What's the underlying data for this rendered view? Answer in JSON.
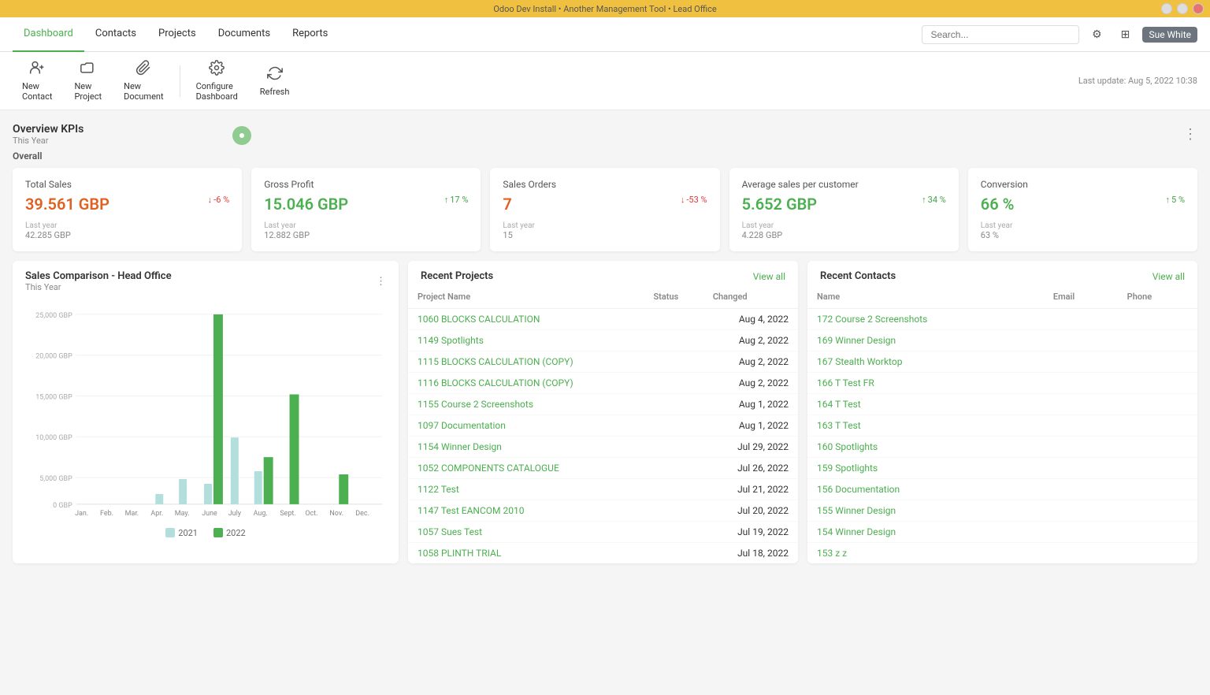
{
  "titleBar": {
    "text": "Odoo Dev Install • Another Management Tool • Lead Office",
    "windowButtons": [
      "minimize",
      "maximize",
      "close"
    ]
  },
  "nav": {
    "items": [
      {
        "label": "Dashboard",
        "active": true
      },
      {
        "label": "Contacts",
        "active": false
      },
      {
        "label": "Projects",
        "active": false
      },
      {
        "label": "Documents",
        "active": false
      },
      {
        "label": "Reports",
        "active": false
      }
    ],
    "search": {
      "placeholder": "Search..."
    },
    "lastUpdate": "Last update: Aug 5, 2022 10:38",
    "userLabel": "Sue White"
  },
  "toolbar": {
    "items": [
      {
        "id": "new-contact",
        "label": "New\nContact",
        "icon": "👤"
      },
      {
        "id": "new-project",
        "label": "New\nProject",
        "icon": "📁"
      },
      {
        "id": "new-document",
        "label": "New\nDocument",
        "icon": "📎"
      },
      {
        "id": "configure-dashboard",
        "label": "Configure\nDashboard",
        "icon": "⚙"
      },
      {
        "id": "refresh",
        "label": "Refresh",
        "icon": "↻"
      }
    ]
  },
  "overviewKPIs": {
    "title": "Overview KPIs",
    "subtitle": "This Year",
    "section": "Overall",
    "cards": [
      {
        "label": "Total Sales",
        "value": "39.561 GBP",
        "valueColor": "red",
        "change": "-6 %",
        "changeDir": "down",
        "lastYearLabel": "Last year",
        "lastYearValue": "42.285 GBP"
      },
      {
        "label": "Gross Profit",
        "value": "15.046 GBP",
        "valueColor": "green",
        "change": "17 %",
        "changeDir": "up",
        "lastYearLabel": "Last year",
        "lastYearValue": "12.882 GBP"
      },
      {
        "label": "Sales Orders",
        "value": "7",
        "valueColor": "red",
        "change": "-53 %",
        "changeDir": "down",
        "lastYearLabel": "Last year",
        "lastYearValue": "15"
      },
      {
        "label": "Average sales per customer",
        "value": "5.652 GBP",
        "valueColor": "green",
        "change": "34 %",
        "changeDir": "up",
        "lastYearLabel": "Last year",
        "lastYearValue": "4.228 GBP"
      },
      {
        "label": "Conversion",
        "value": "66 %",
        "valueColor": "green",
        "change": "5 %",
        "changeDir": "up",
        "lastYearLabel": "Last year",
        "lastYearValue": "63 %"
      }
    ]
  },
  "salesComparison": {
    "title": "Sales Comparison  -  Head Office",
    "subtitle": "This Year",
    "legend": [
      {
        "label": "2021",
        "color": "#b2dfdb"
      },
      {
        "label": "2022",
        "color": "#4CAF50"
      }
    ],
    "months": [
      "Jan.",
      "Feb.",
      "Mar.",
      "Apr.",
      "May.",
      "June",
      "July",
      "Aug.",
      "Sept.",
      "Oct.",
      "Nov.",
      "Dec."
    ],
    "yLabels": [
      "25,000 GBP",
      "20,000 GBP",
      "15,000 GBP",
      "10,000 GBP",
      "5,000 GBP",
      "0 GBP"
    ],
    "data2021": [
      0,
      0,
      0,
      1200,
      3200,
      2600,
      8500,
      4200,
      0,
      0,
      0,
      0
    ],
    "data2022": [
      0,
      0,
      0,
      0,
      0,
      22000,
      0,
      6000,
      14000,
      0,
      3800,
      0
    ]
  },
  "recentProjects": {
    "title": "Recent Projects",
    "viewAll": "View all",
    "columns": [
      "Project Name",
      "Status",
      "Changed"
    ],
    "rows": [
      {
        "name": "1060 BLOCKS CALCULATION",
        "status": "",
        "changed": "Aug 4, 2022"
      },
      {
        "name": "1149 Spotlights",
        "status": "",
        "changed": "Aug 2, 2022"
      },
      {
        "name": "1115 BLOCKS CALCULATION (COPY)",
        "status": "",
        "changed": "Aug 2, 2022"
      },
      {
        "name": "1116 BLOCKS CALCULATION (COPY)",
        "status": "",
        "changed": "Aug 2, 2022"
      },
      {
        "name": "1155 Course 2 Screenshots",
        "status": "",
        "changed": "Aug 1, 2022"
      },
      {
        "name": "1097 Documentation",
        "status": "",
        "changed": "Aug 1, 2022"
      },
      {
        "name": "1154 Winner Design",
        "status": "",
        "changed": "Jul 29, 2022"
      },
      {
        "name": "1052 COMPONENTS CATALOGUE",
        "status": "",
        "changed": "Jul 26, 2022"
      },
      {
        "name": "1122 Test",
        "status": "",
        "changed": "Jul 21, 2022"
      },
      {
        "name": "1147 Test EANCOM 2010",
        "status": "",
        "changed": "Jul 20, 2022"
      },
      {
        "name": "1057 Sues Test",
        "status": "",
        "changed": "Jul 19, 2022"
      },
      {
        "name": "1058 PLINTH TRIAL",
        "status": "",
        "changed": "Jul 18, 2022"
      }
    ]
  },
  "recentContacts": {
    "title": "Recent Contacts",
    "viewAll": "View all",
    "columns": [
      "Name",
      "Email",
      "Phone"
    ],
    "rows": [
      {
        "name": "172 Course 2 Screenshots",
        "email": "",
        "phone": ""
      },
      {
        "name": "169 Winner Design",
        "email": "",
        "phone": ""
      },
      {
        "name": "167 Stealth Worktop",
        "email": "",
        "phone": ""
      },
      {
        "name": "166 T Test FR",
        "email": "",
        "phone": ""
      },
      {
        "name": "164 T Test",
        "email": "",
        "phone": ""
      },
      {
        "name": "163 T Test",
        "email": "",
        "phone": ""
      },
      {
        "name": "160 Spotlights",
        "email": "",
        "phone": ""
      },
      {
        "name": "159 Spotlights",
        "email": "",
        "phone": ""
      },
      {
        "name": "156 Documentation",
        "email": "",
        "phone": ""
      },
      {
        "name": "155 Winner Design",
        "email": "",
        "phone": ""
      },
      {
        "name": "154 Winner Design",
        "email": "",
        "phone": ""
      },
      {
        "name": "153 z z",
        "email": "",
        "phone": ""
      }
    ]
  }
}
